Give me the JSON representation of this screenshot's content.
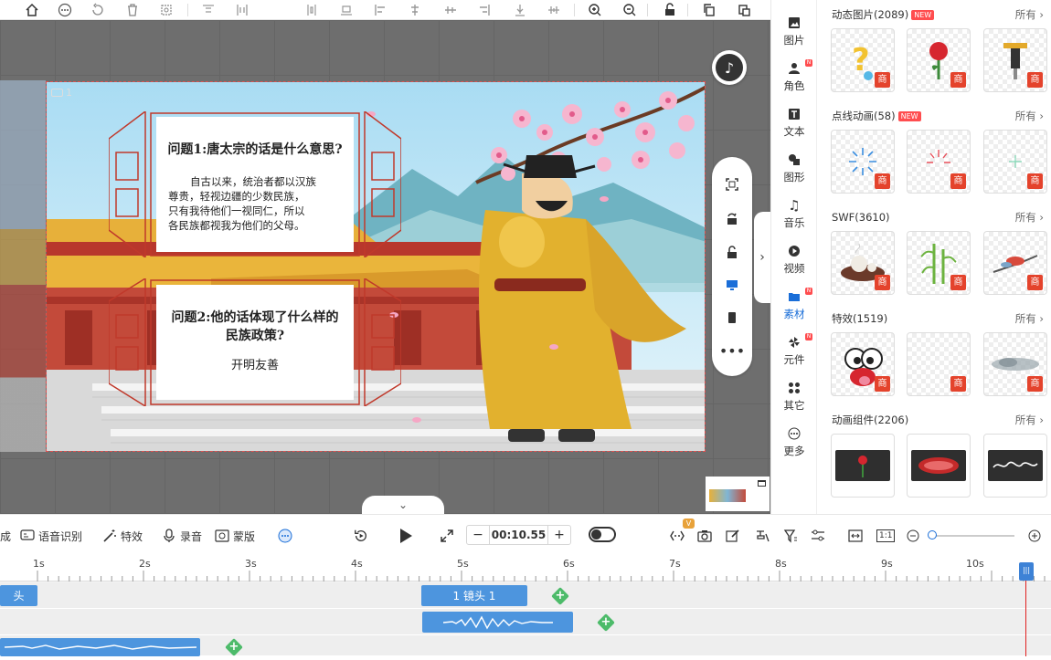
{
  "categories": [
    {
      "key": "image",
      "label": "图片",
      "badge": false
    },
    {
      "key": "role",
      "label": "角色",
      "badge": true
    },
    {
      "key": "text",
      "label": "文本",
      "badge": false
    },
    {
      "key": "shape",
      "label": "图形",
      "badge": false
    },
    {
      "key": "music",
      "label": "音乐",
      "badge": false
    },
    {
      "key": "video",
      "label": "视频",
      "badge": false
    },
    {
      "key": "material",
      "label": "素材",
      "badge": true,
      "active": true
    },
    {
      "key": "element",
      "label": "元件",
      "badge": true
    },
    {
      "key": "other",
      "label": "其它",
      "badge": false
    },
    {
      "key": "more",
      "label": "更多",
      "badge": false
    }
  ],
  "assets": {
    "more_label": "所有",
    "new_label": "NEW",
    "shang_label": "商",
    "sections": [
      {
        "title": "动态图片(2089)",
        "new": true
      },
      {
        "title": "点线动画(58)",
        "new": true
      },
      {
        "title": "SWF(3610)",
        "new": false
      },
      {
        "title": "特效(1519)",
        "new": false
      },
      {
        "title": "动画组件(2206)",
        "new": false
      }
    ]
  },
  "stage": {
    "shot_number": "1",
    "q1": {
      "title": "问题1:唐太宗的话是什么意思?",
      "lines": [
        "自古以来，统治者都以汉族",
        "尊贵，轻视边疆的少数民族，",
        "只有我待他们一视同仁，所以",
        "各民族都视我为他们的父母。"
      ]
    },
    "q2": {
      "title_line1": "问题2:他的话体现了什么样的",
      "title_line2": "民族政策?",
      "answer": "开明友善"
    }
  },
  "bottom_bar": {
    "cut_label": "成",
    "speech_label": "语音识别",
    "effect_label": "特效",
    "record_label": "录音",
    "mask_label": "蒙版",
    "time_minus": "−",
    "time_value": "00:10.55",
    "time_plus": "+",
    "ratio_label": "1:1",
    "vip_label": "V"
  },
  "timeline": {
    "ticks": [
      "1s",
      "2s",
      "3s",
      "4s",
      "5s",
      "6s",
      "7s",
      "8s",
      "9s",
      "10s"
    ],
    "clip_prev_label": "头",
    "clip_shot_label": "1 镜头 1"
  },
  "colors": {
    "accent": "#1a6ed8",
    "clip": "#4d95de",
    "keyframe": "#4dbb6a",
    "new_badge": "#ff4d4f",
    "shang": "#e4432c",
    "playhead": "#e02020"
  }
}
